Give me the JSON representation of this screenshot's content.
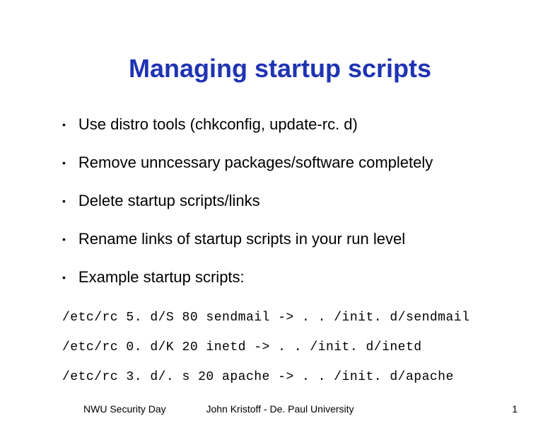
{
  "title": "Managing startup scripts",
  "bullets": [
    "Use distro tools (chkconfig, update-rc. d)",
    "Remove unncessary packages/software completely",
    "Delete startup scripts/links",
    "Rename links of startup scripts in your run level",
    "Example startup scripts:"
  ],
  "code_lines": [
    "/etc/rc 5. d/S 80 sendmail -> . . /init. d/sendmail",
    "/etc/rc 0. d/K 20 inetd -> . . /init. d/inetd",
    "/etc/rc 3. d/. s 20 apache -> . . /init. d/apache"
  ],
  "footer": {
    "left": "NWU Security Day",
    "center": "John Kristoff - De. Paul University",
    "right": "1"
  },
  "colors": {
    "title": "#1f33b3",
    "text": "#000000",
    "bg": "#ffffff"
  }
}
